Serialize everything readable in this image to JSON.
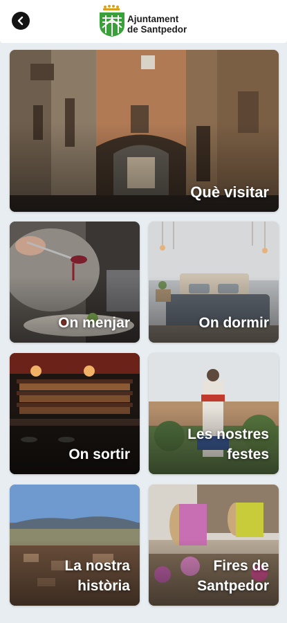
{
  "header": {
    "back_icon": "arrow-left-icon",
    "logo_line1": "Ajuntament",
    "logo_line2": "de Santpedor",
    "brand_color": "#3aa13a"
  },
  "tiles": [
    {
      "label_line1": "Què visitar",
      "label_line2": ""
    },
    {
      "label_line1": "On menjar",
      "label_line2": ""
    },
    {
      "label_line1": "On dormir",
      "label_line2": ""
    },
    {
      "label_line1": "On sortir",
      "label_line2": ""
    },
    {
      "label_line1": "Les nostres",
      "label_line2": "festes"
    },
    {
      "label_line1": "La nostra",
      "label_line2": "història"
    },
    {
      "label_line1": "Fires de",
      "label_line2": "Santpedor"
    }
  ]
}
